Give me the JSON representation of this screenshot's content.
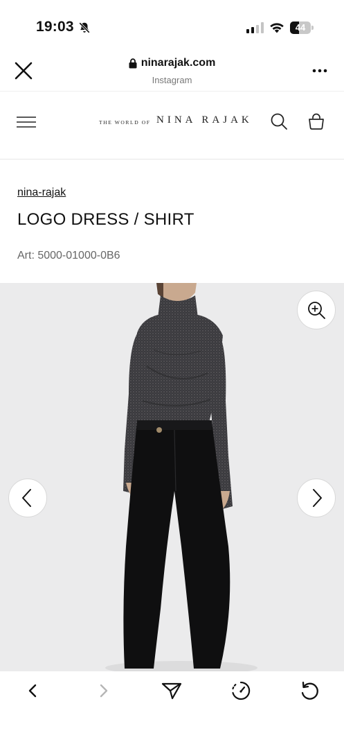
{
  "status_bar": {
    "time": "19:03",
    "battery_level": "44",
    "battery_fraction": 0.44,
    "icons": [
      "bell-slash-icon",
      "cellular-signal-icon",
      "wifi-icon",
      "battery-icon"
    ]
  },
  "browser": {
    "url": "ninarajak.com",
    "source": "Instagram",
    "icons": [
      "close-icon",
      "lock-icon",
      "more-icon"
    ]
  },
  "site_header": {
    "brand_prefix": "THE WORLD OF",
    "brand_name": "NINA RAJAK",
    "icons": [
      "menu-icon",
      "search-icon",
      "bag-icon"
    ]
  },
  "product": {
    "brand": "nina-rajak",
    "title": "LOGO DRESS / SHIRT",
    "art_number": "Art: 5000-01000-0B6"
  },
  "gallery": {
    "icons": [
      "zoom-in-icon",
      "chevron-left-icon",
      "chevron-right-icon"
    ]
  },
  "toolbar": {
    "icons": [
      "back-icon",
      "forward-icon",
      "share-icon",
      "speed-icon",
      "reload-icon"
    ]
  },
  "colors": {
    "background": "#ffffff",
    "image_bg": "#ebebec",
    "text": "#111111",
    "muted": "#666666"
  }
}
